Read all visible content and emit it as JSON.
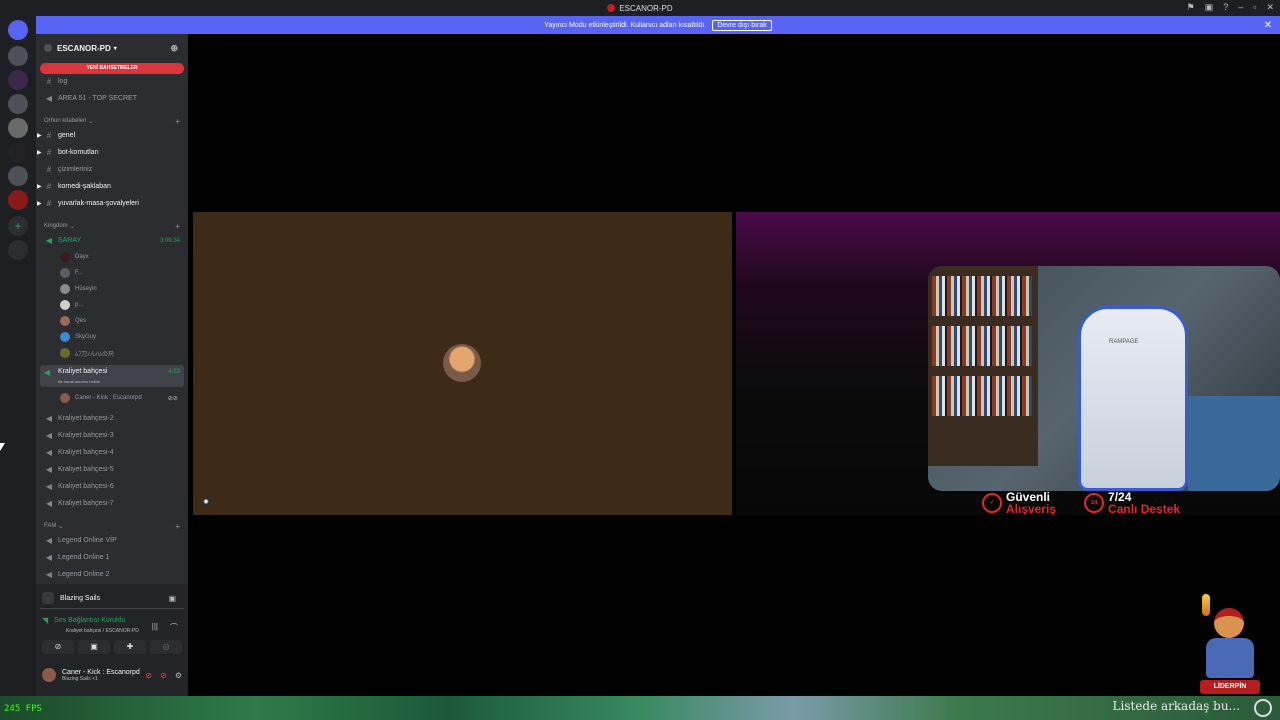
{
  "window": {
    "title": "ESCANOR-PD"
  },
  "banner": {
    "text": "Yayıncı Modu etkinleştirildi. Kullanıcı adları kısaltıldı.",
    "button": "Devre dışı bırak"
  },
  "server": {
    "name": "ESCANOR-PD",
    "mentions_pill": "YENİ BAHSETMELER"
  },
  "channels_top": [
    {
      "name": "log",
      "type": "text"
    },
    {
      "name": "AREA 51 - TOP SECRET",
      "type": "voice"
    }
  ],
  "category1": {
    "name": "Orhun kitabeleri"
  },
  "text_channels": [
    {
      "name": "genel",
      "unread": true
    },
    {
      "name": "bot-komutları",
      "unread": true
    },
    {
      "name": "çizimleriniz",
      "unread": false
    },
    {
      "name": "komedi-şaklaban",
      "unread": true
    },
    {
      "name": "yuvarlak-masa-şovalyeleri",
      "unread": true
    }
  ],
  "category2": {
    "name": "Kingdom"
  },
  "saray": {
    "name": "SARAY",
    "timer": "3:09:34"
  },
  "saray_users": [
    "Dayx",
    "F...",
    "Hüseyin",
    "p...",
    "Qes",
    "SkyGuy",
    "ﾑﾌ刀ﾉんﾊﾑの尺"
  ],
  "active_vc": {
    "name": "Kraliyet bahçesi",
    "status": "Bir kanal durumu belirle",
    "timer": "4:33",
    "user": "Caner - Kick : Escanorpd"
  },
  "voice_channels": [
    "Kraliyet bahçesi-2",
    "Kraliyet bahçesi-3",
    "Kraliyet bahçesi-4",
    "Kraliyet bahçesi-5",
    "Kraliyet bahçesi-6",
    "Kraliyet bahçesi-7"
  ],
  "category3": {
    "name": "FAM"
  },
  "fam_channels": [
    "Legend Online VİP",
    "Legend Online 1",
    "Legend Online 2"
  ],
  "panel": {
    "game": "Blazing Sails",
    "connection": "Ses Bağlantısı Kuruldu",
    "connection_sub": "Kraliyet bahçesi / ESCANOR-PD",
    "user": "Caner - Kick : Escanorpd",
    "user_sub": "Blazing Sails +1"
  },
  "stream": {
    "chair_brand": "RAMPAGE",
    "promo1": {
      "line1": "Güvenli",
      "line2": "Alışveriş"
    },
    "promo2": {
      "badge": "24",
      "line1": "7/24",
      "line2": "Canlı Destek"
    },
    "mascot_logo": "LİDERPİN"
  },
  "overlay": {
    "fps": "245 FPS",
    "hint": "Listede arkadaş bu..."
  },
  "colors": {
    "accent": "#5865f2",
    "online": "#23a55a",
    "danger": "#da373c"
  }
}
